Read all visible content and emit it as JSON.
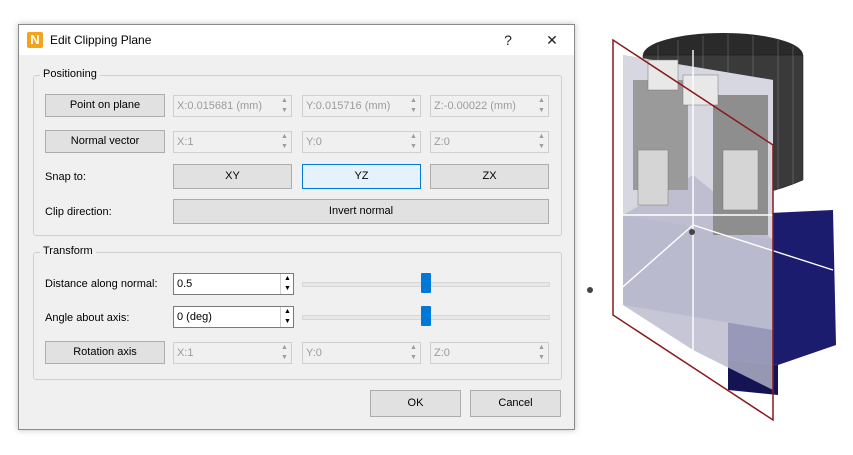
{
  "dialog": {
    "title": "Edit Clipping Plane",
    "help_label": "?",
    "close_label": "✕",
    "app_icon_letter": "N",
    "accent_color": "#0078d7"
  },
  "positioning": {
    "title": "Positioning",
    "point_button": "Point on plane",
    "point_x": "X:0.015681 (mm)",
    "point_y": "Y:0.015716 (mm)",
    "point_z": "Z:-0.00022 (mm)",
    "normal_button": "Normal vector",
    "normal_x": "X:1",
    "normal_y": "Y:0",
    "normal_z": "Z:0",
    "snap_label": "Snap to:",
    "snap_xy": "XY",
    "snap_yz": "YZ",
    "snap_zx": "ZX",
    "snap_selected": "YZ",
    "clip_label": "Clip direction:",
    "invert_button": "Invert normal"
  },
  "transform": {
    "title": "Transform",
    "distance_label": "Distance along normal:",
    "distance_value": "0.5",
    "distance_slider_level": 0.5,
    "angle_label": "Angle about axis:",
    "angle_value": "0 (deg)",
    "angle_slider_level": 0.5,
    "rotation_button": "Rotation axis",
    "axis_x": "X:1",
    "axis_y": "Y:0",
    "axis_z": "Z:0"
  },
  "footer": {
    "ok": "OK",
    "cancel": "Cancel"
  },
  "viewport": {
    "plane_color": "#8b1a1a",
    "cut_face_color": "#b8b8cc",
    "body_color": "#1a1a66"
  }
}
